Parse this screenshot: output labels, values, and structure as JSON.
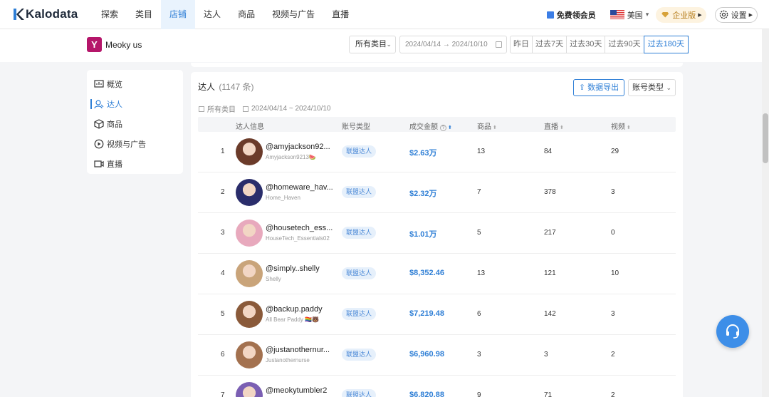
{
  "brand": {
    "name": "Kalodata"
  },
  "nav": {
    "items": [
      {
        "label": "探索"
      },
      {
        "label": "类目"
      },
      {
        "label": "店铺",
        "active": true
      },
      {
        "label": "达人"
      },
      {
        "label": "商品"
      },
      {
        "label": "视频与广告"
      },
      {
        "label": "直播"
      }
    ],
    "vip_label": "免费领会员",
    "region_label": "美国",
    "enterprise_label": "企业版",
    "settings_label": "设置"
  },
  "shop": {
    "name": "Meoky us",
    "logo_letter": "Y",
    "category_select": "所有类目",
    "date_range": "2024/04/14 → 2024/10/10",
    "ranges": [
      "昨日",
      "过去7天",
      "过去30天",
      "过去90天",
      "过去180天"
    ],
    "active_range": "过去180天"
  },
  "sidebar": {
    "items": [
      {
        "label": "概览",
        "icon": "overview-icon"
      },
      {
        "label": "达人",
        "icon": "influencer-icon",
        "active": true
      },
      {
        "label": "商品",
        "icon": "box-icon"
      },
      {
        "label": "视频与广告",
        "icon": "play-icon"
      },
      {
        "label": "直播",
        "icon": "live-camera-icon"
      }
    ]
  },
  "panel": {
    "title": "达人",
    "count": "(1147 条)",
    "export_label": "数据导出",
    "account_type_select": "账号类型",
    "filter_category": "所有类目",
    "filter_dates": "2024/04/14 ~ 2024/10/10",
    "columns": {
      "influencer": "达人信息",
      "account_type": "账号类型",
      "gmv": "成交金额",
      "goods": "商品",
      "live": "直播",
      "video": "视频"
    }
  },
  "rows": [
    {
      "rank": "1",
      "handle": "@amyjackson92...",
      "nick": "Amyjackson9213🍉",
      "type": "联盟达人",
      "gmv": "$2.63万",
      "goods": "13",
      "live": "84",
      "video": "29",
      "avatar_color": "#6b3b2a"
    },
    {
      "rank": "2",
      "handle": "@homeware_hav...",
      "nick": "Home_Haven",
      "type": "联盟达人",
      "gmv": "$2.32万",
      "goods": "7",
      "live": "378",
      "video": "3",
      "avatar_color": "#2a2d6b"
    },
    {
      "rank": "3",
      "handle": "@housetech_ess...",
      "nick": "HouseTech_Essentials02",
      "type": "联盟达人",
      "gmv": "$1.01万",
      "goods": "5",
      "live": "217",
      "video": "0",
      "avatar_color": "#e8a9bd"
    },
    {
      "rank": "4",
      "handle": "@simply..shelly",
      "nick": "Shelly",
      "type": "联盟达人",
      "gmv": "$8,352.46",
      "goods": "13",
      "live": "121",
      "video": "10",
      "avatar_color": "#c9a47a"
    },
    {
      "rank": "5",
      "handle": "@backup.paddy",
      "nick": "All Bear Paddy 🏳️‍🌈🐻",
      "type": "联盟达人",
      "gmv": "$7,219.48",
      "goods": "6",
      "live": "142",
      "video": "3",
      "avatar_color": "#8a5a3a"
    },
    {
      "rank": "6",
      "handle": "@justanothernur...",
      "nick": "Justanothernurse",
      "type": "联盟达人",
      "gmv": "$6,960.98",
      "goods": "3",
      "live": "3",
      "video": "2",
      "avatar_color": "#a3714f"
    },
    {
      "rank": "7",
      "handle": "@meokytumbler2",
      "nick": "",
      "type": "联盟达人",
      "gmv": "$6,820.88",
      "goods": "9",
      "live": "71",
      "video": "2",
      "avatar_color": "#7b5fb3"
    }
  ]
}
